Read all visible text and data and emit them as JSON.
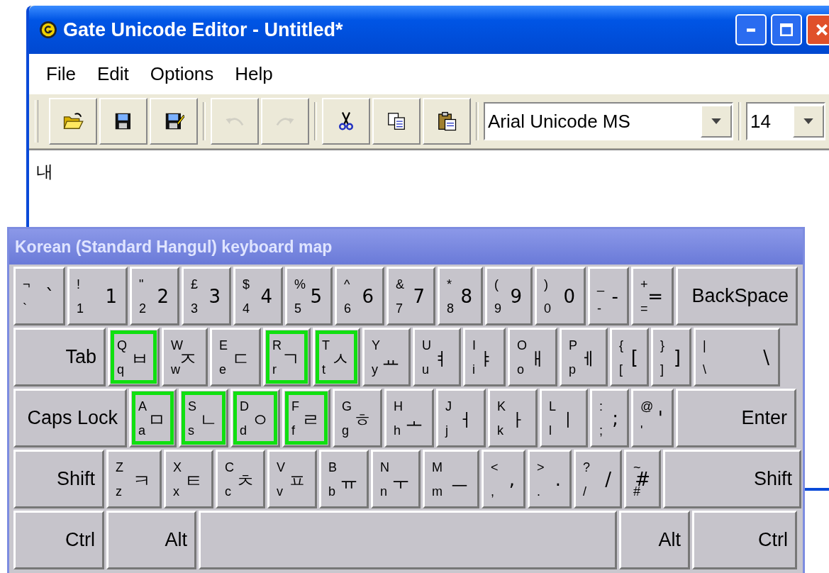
{
  "window": {
    "title": "Gate Unicode Editor - Untitled*"
  },
  "menu": [
    "File",
    "Edit",
    "Options",
    "Help"
  ],
  "toolbar": [
    {
      "kind": "open",
      "disabled": false
    },
    {
      "kind": "save",
      "disabled": false
    },
    {
      "kind": "saveas",
      "disabled": false
    },
    {
      "kind": "undo",
      "disabled": true
    },
    {
      "kind": "redo",
      "disabled": true
    },
    {
      "kind": "cut",
      "disabled": false
    },
    {
      "kind": "copy",
      "disabled": false
    },
    {
      "kind": "paste",
      "disabled": false
    }
  ],
  "font": {
    "value": "Arial Unicode MS"
  },
  "size": {
    "value": "14"
  },
  "editor": {
    "text": "내"
  },
  "keyboard": {
    "title": "Korean (Standard Hangul) keyboard map",
    "rows": [
      {
        "keys": [
          {
            "kind": "char",
            "upper": "¬",
            "lower": "`",
            "main": "`",
            "highlighted": false
          },
          {
            "kind": "char",
            "upper": "!",
            "lower": "1",
            "main": "1",
            "highlighted": false
          },
          {
            "kind": "char",
            "upper": "\"",
            "lower": "2",
            "main": "2",
            "highlighted": false
          },
          {
            "kind": "char",
            "upper": "£",
            "lower": "3",
            "main": "3",
            "highlighted": false
          },
          {
            "kind": "char",
            "upper": "$",
            "lower": "4",
            "main": "4",
            "highlighted": false
          },
          {
            "kind": "char",
            "upper": "%",
            "lower": "5",
            "main": "5",
            "highlighted": false
          },
          {
            "kind": "char",
            "upper": "^",
            "lower": "6",
            "main": "6",
            "highlighted": false
          },
          {
            "kind": "char",
            "upper": "&",
            "lower": "7",
            "main": "7",
            "highlighted": false
          },
          {
            "kind": "char",
            "upper": "*",
            "lower": "8",
            "main": "8",
            "highlighted": false
          },
          {
            "kind": "char",
            "upper": "(",
            "lower": "9",
            "main": "9",
            "highlighted": false
          },
          {
            "kind": "char",
            "upper": ")",
            "lower": "0",
            "main": "0",
            "highlighted": false
          },
          {
            "kind": "char",
            "upper": "_",
            "lower": "-",
            "main": "-",
            "highlighted": false
          },
          {
            "kind": "char",
            "upper": "+",
            "lower": "=",
            "main": "=",
            "highlighted": false
          },
          {
            "kind": "label",
            "label": "BackSpace"
          }
        ]
      },
      {
        "keys": [
          {
            "kind": "label",
            "label": "Tab"
          },
          {
            "kind": "char",
            "upper": "Q",
            "lower": "q",
            "main": "ㅂ",
            "highlighted": true
          },
          {
            "kind": "char",
            "upper": "W",
            "lower": "w",
            "main": "ㅈ",
            "highlighted": false
          },
          {
            "kind": "char",
            "upper": "E",
            "lower": "e",
            "main": "ㄷ",
            "highlighted": false
          },
          {
            "kind": "char",
            "upper": "R",
            "lower": "r",
            "main": "ㄱ",
            "highlighted": true
          },
          {
            "kind": "char",
            "upper": "T",
            "lower": "t",
            "main": "ㅅ",
            "highlighted": true
          },
          {
            "kind": "char",
            "upper": "Y",
            "lower": "y",
            "main": "ㅛ",
            "highlighted": false
          },
          {
            "kind": "char",
            "upper": "U",
            "lower": "u",
            "main": "ㅕ",
            "highlighted": false
          },
          {
            "kind": "char",
            "upper": "I",
            "lower": "i",
            "main": "ㅑ",
            "highlighted": false
          },
          {
            "kind": "char",
            "upper": "O",
            "lower": "o",
            "main": "ㅐ",
            "highlighted": false
          },
          {
            "kind": "char",
            "upper": "P",
            "lower": "p",
            "main": "ㅔ",
            "highlighted": false
          },
          {
            "kind": "char",
            "upper": "{",
            "lower": "[",
            "main": "[",
            "highlighted": false
          },
          {
            "kind": "char",
            "upper": "}",
            "lower": "]",
            "main": "]",
            "highlighted": false
          },
          {
            "kind": "char",
            "upper": "|",
            "lower": "\\",
            "main": "\\",
            "highlighted": false
          }
        ]
      },
      {
        "keys": [
          {
            "kind": "label",
            "label": "Caps Lock"
          },
          {
            "kind": "char",
            "upper": "A",
            "lower": "a",
            "main": "ㅁ",
            "highlighted": true
          },
          {
            "kind": "char",
            "upper": "S",
            "lower": "s",
            "main": "ㄴ",
            "highlighted": true
          },
          {
            "kind": "char",
            "upper": "D",
            "lower": "d",
            "main": "ㅇ",
            "highlighted": true
          },
          {
            "kind": "char",
            "upper": "F",
            "lower": "f",
            "main": "ㄹ",
            "highlighted": true
          },
          {
            "kind": "char",
            "upper": "G",
            "lower": "g",
            "main": "ㅎ",
            "highlighted": false
          },
          {
            "kind": "char",
            "upper": "H",
            "lower": "h",
            "main": "ㅗ",
            "highlighted": false
          },
          {
            "kind": "char",
            "upper": "J",
            "lower": "j",
            "main": "ㅓ",
            "highlighted": false
          },
          {
            "kind": "char",
            "upper": "K",
            "lower": "k",
            "main": "ㅏ",
            "highlighted": false
          },
          {
            "kind": "char",
            "upper": "L",
            "lower": "l",
            "main": "ㅣ",
            "highlighted": false
          },
          {
            "kind": "char",
            "upper": ":",
            "lower": ";",
            "main": ";",
            "highlighted": false
          },
          {
            "kind": "char",
            "upper": "@",
            "lower": "'",
            "main": "'",
            "highlighted": false
          },
          {
            "kind": "label",
            "label": "Enter"
          }
        ]
      },
      {
        "keys": [
          {
            "kind": "label",
            "label": "Shift"
          },
          {
            "kind": "char",
            "upper": "Z",
            "lower": "z",
            "main": "ㅋ",
            "highlighted": false
          },
          {
            "kind": "char",
            "upper": "X",
            "lower": "x",
            "main": "ㅌ",
            "highlighted": false
          },
          {
            "kind": "char",
            "upper": "C",
            "lower": "c",
            "main": "ㅊ",
            "highlighted": false
          },
          {
            "kind": "char",
            "upper": "V",
            "lower": "v",
            "main": "ㅍ",
            "highlighted": false
          },
          {
            "kind": "char",
            "upper": "B",
            "lower": "b",
            "main": "ㅠ",
            "highlighted": false
          },
          {
            "kind": "char",
            "upper": "N",
            "lower": "n",
            "main": "ㅜ",
            "highlighted": false
          },
          {
            "kind": "char",
            "upper": "M",
            "lower": "m",
            "main": "ㅡ",
            "highlighted": false
          },
          {
            "kind": "char",
            "upper": "<",
            "lower": ",",
            "main": ",",
            "highlighted": false
          },
          {
            "kind": "char",
            "upper": ">",
            "lower": ".",
            "main": ".",
            "highlighted": false
          },
          {
            "kind": "char",
            "upper": "?",
            "lower": "/",
            "main": "/",
            "highlighted": false
          },
          {
            "kind": "char",
            "upper": "~",
            "lower": "#",
            "main": "#",
            "highlighted": false
          },
          {
            "kind": "label",
            "label": "Shift"
          }
        ]
      },
      {
        "keys": [
          {
            "kind": "label",
            "label": "Ctrl"
          },
          {
            "kind": "label",
            "label": "Alt"
          },
          {
            "kind": "space"
          },
          {
            "kind": "label",
            "label": "Alt"
          },
          {
            "kind": "label",
            "label": "Ctrl"
          }
        ]
      }
    ]
  }
}
